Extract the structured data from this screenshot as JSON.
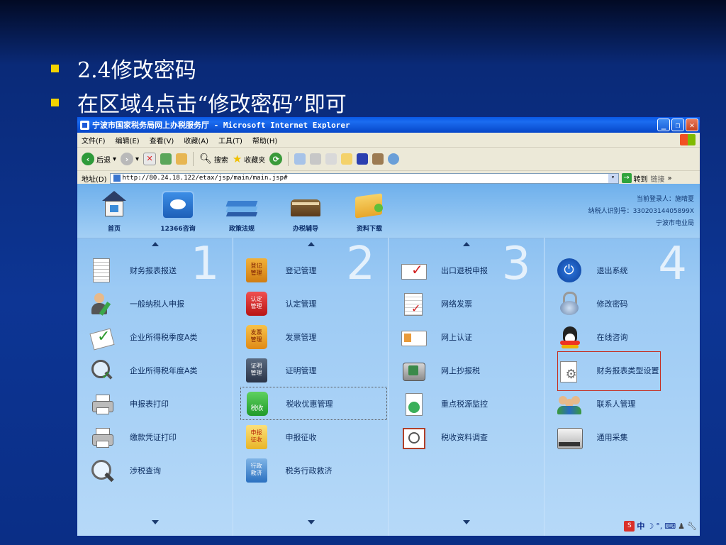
{
  "slide": {
    "bullets": [
      "2.4修改密码",
      "在区域4点击“修改密码”即可"
    ]
  },
  "window": {
    "title": "宁波市国家税务局网上办税服务厅 - Microsoft Internet Explorer",
    "menu": [
      "文件(F)",
      "编辑(E)",
      "查看(V)",
      "收藏(A)",
      "工具(T)",
      "帮助(H)"
    ],
    "toolbar": {
      "back": "后退",
      "search": "搜索",
      "favorites": "收藏夹"
    },
    "address": {
      "label": "地址(D)",
      "url": "http://80.24.18.122/etax/jsp/main/main.jsp#",
      "go": "转到",
      "links": "链接"
    }
  },
  "header": {
    "nav": [
      {
        "label": "首页",
        "icon": "home-icon"
      },
      {
        "label": "12366咨询",
        "icon": "consult-icon"
      },
      {
        "label": "政策法规",
        "icon": "policy-icon"
      },
      {
        "label": "办税辅导",
        "icon": "guide-icon"
      },
      {
        "label": "资料下载",
        "icon": "download-folder-icon"
      }
    ],
    "user": {
      "login": "当前登录人：施晴夏",
      "taxpayer_id": "纳税人识别号：33020314405899X",
      "bureau": "宁波市电业局"
    }
  },
  "columns": [
    {
      "number": "1",
      "items": [
        "财务报表报送",
        "一般纳税人申报",
        "企业所得税季度A类",
        "企业所得税年度A类",
        "申报表打印",
        "缴款凭证打印",
        "涉税查询"
      ]
    },
    {
      "number": "2",
      "items": [
        "登记管理",
        "认定管理",
        "发票管理",
        "证明管理",
        "税收优惠管理",
        "申报征收",
        "税务行政救济"
      ]
    },
    {
      "number": "3",
      "items": [
        "出口退税申报",
        "网络发票",
        "网上认证",
        "网上抄报税",
        "重点税源监控",
        "税收资料调查"
      ]
    },
    {
      "number": "4",
      "items": [
        "退出系统",
        "修改密码",
        "在线咨询",
        "财务报表类型设置",
        "联系人管理",
        "通用采集"
      ]
    }
  ],
  "icon_text": {
    "register": "登记\n管理",
    "rz": "认定\n管理",
    "fp": "发票\n管理",
    "zm": "证明\n管理",
    "ss": "税收",
    "sb": "申报\n征收",
    "xz": "行政\n救济"
  },
  "status_ime": "中"
}
